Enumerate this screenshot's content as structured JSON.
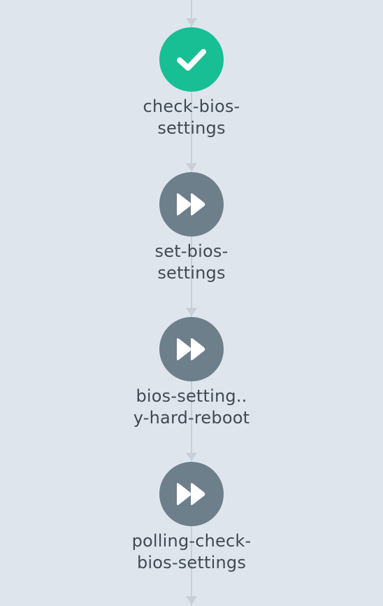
{
  "workflow": {
    "nodes": [
      {
        "name": "check-bios-settings",
        "label_lines": [
          "check-bios-",
          "settings"
        ],
        "status": "succeeded",
        "icon": "check-icon",
        "color": "#18be94"
      },
      {
        "name": "set-bios-settings",
        "label_lines": [
          "set-bios-",
          "settings"
        ],
        "status": "skipped",
        "icon": "fast-forward-icon",
        "color": "#6d7f8b"
      },
      {
        "name": "bios-settings-apply-hard-reboot",
        "label_lines": [
          "bios-setting..",
          "y-hard-reboot"
        ],
        "status": "skipped",
        "icon": "fast-forward-icon",
        "color": "#6d7f8b"
      },
      {
        "name": "polling-check-bios-settings",
        "label_lines": [
          "polling-check-",
          "bios-settings"
        ],
        "status": "skipped",
        "icon": "fast-forward-icon",
        "color": "#6d7f8b"
      }
    ],
    "edge_color": "#c7d0d9"
  }
}
